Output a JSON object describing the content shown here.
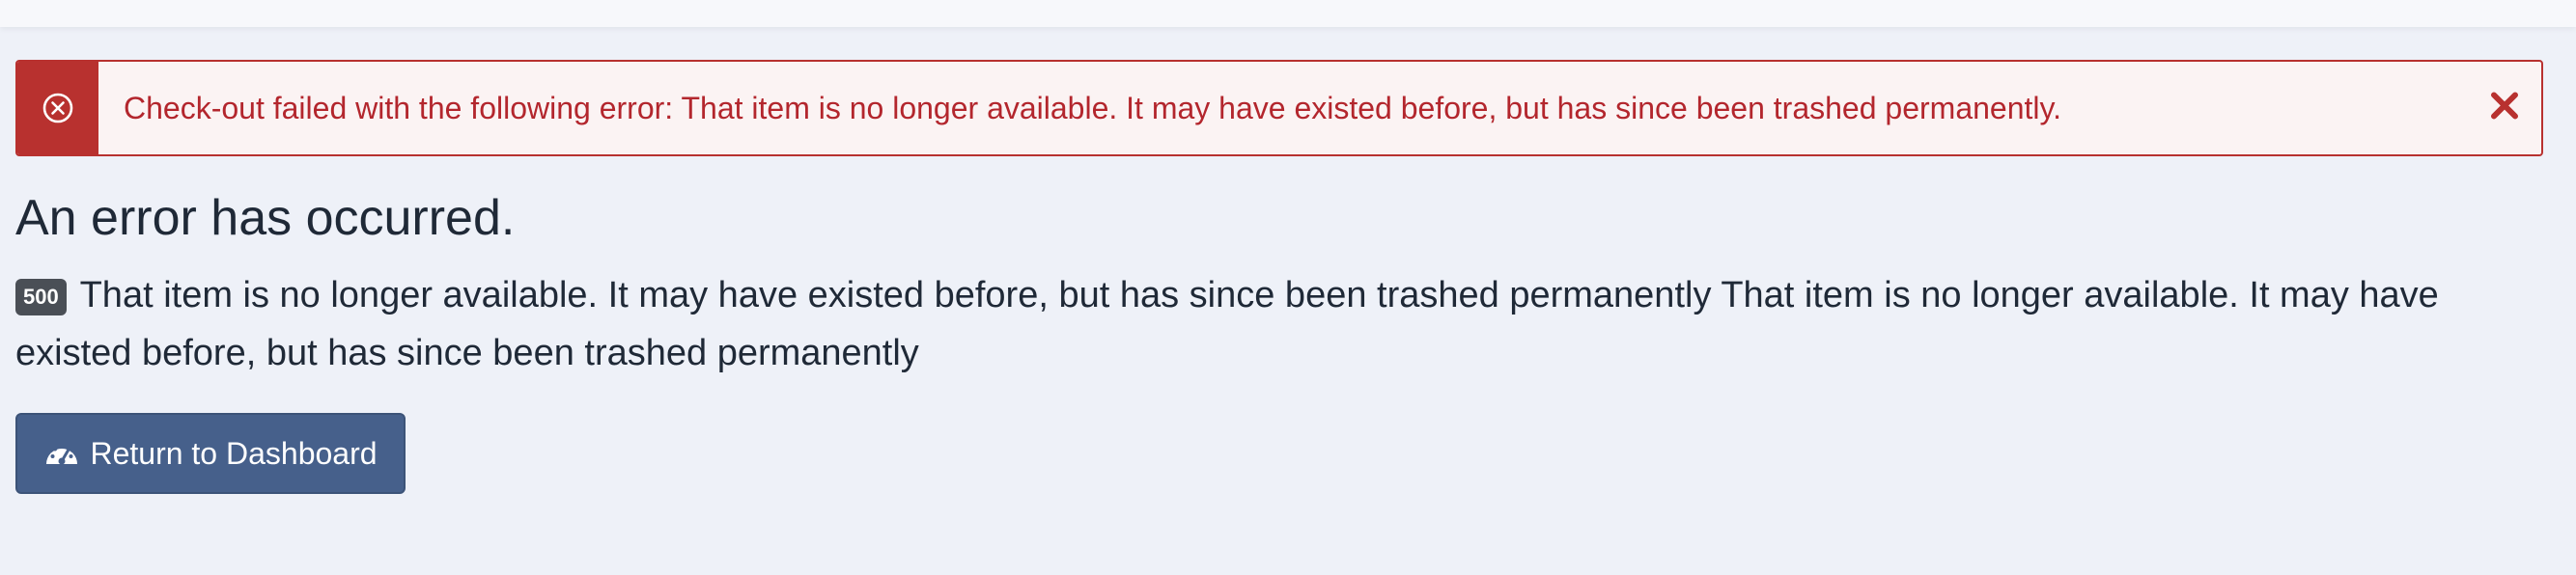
{
  "alert": {
    "icon": "circle-x-icon",
    "message": "Check-out failed with the following error: That item is no longer available. It may have existed before, but has since been trashed permanently.",
    "close_icon": "close-icon",
    "colors": {
      "border": "#b8312f",
      "text": "#b3262d",
      "background": "#fbf3f3"
    }
  },
  "error": {
    "heading": "An error has occurred.",
    "code": "500",
    "message": "That item is no longer available. It may have existed before, but has since been trashed permanently That item is no longer available. It may have existed before, but has since been trashed permanently"
  },
  "actions": {
    "return_label": "Return to Dashboard",
    "return_icon": "dashboard-gauge-icon",
    "button_color": "#46608b"
  }
}
